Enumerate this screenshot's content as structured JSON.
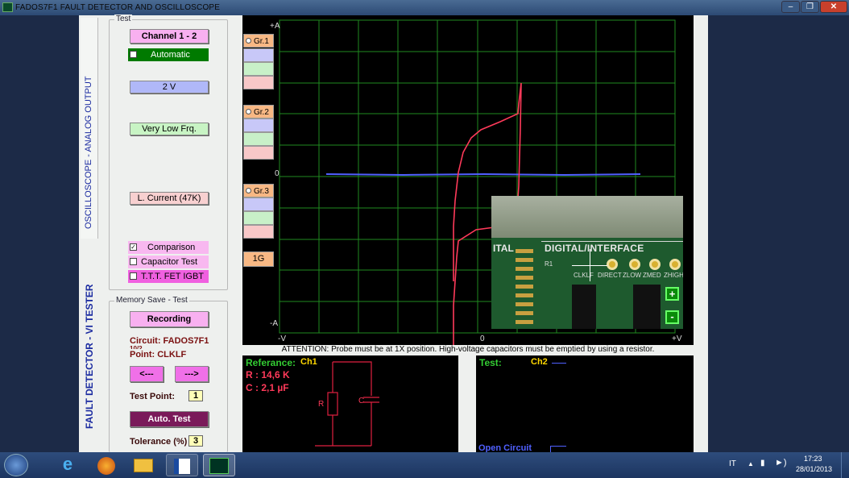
{
  "window": {
    "title": "FADOS7F1   FAULT DETECTOR AND OSCILLOSCOPE"
  },
  "tabs": {
    "oscilloscope": "OSCILLOSCOPE  -  ANALOG OUTPUT",
    "tester": "FAULT DETECTOR - VI TESTER"
  },
  "test_group": {
    "legend": "Test",
    "channel_button": "Channel 1 - 2",
    "automatic_label": "Automatic",
    "voltage_button": "2 V",
    "frequency_button": "Very Low Frq.",
    "current_button": "L. Current (47K)",
    "comparison_label": "Comparison",
    "capacitor_label": "Capacitor Test",
    "ttt_label": "T.T.T. FET  IGBT"
  },
  "memory_group": {
    "legend": "Memory Save - Test",
    "recording_button": "Recording",
    "circuit_text": "Circuit: FADOS7F1",
    "circuit_partial": "10/2",
    "point_text": "Point:  CLKLF",
    "prev_button": "<---",
    "next_button": "--->",
    "test_point_label": "Test Point:",
    "test_point_value": "1",
    "auto_test_button": "Auto. Test",
    "tolerance_label": "Tolerance (%)",
    "tolerance_value": "3"
  },
  "graph_buttons": [
    "Gr.1",
    "Gr.2",
    "Gr.3"
  ],
  "gain_button": "1G",
  "scope": {
    "top_label": "+A",
    "bottom_label": "-A",
    "zero_label": "0",
    "left_label": "-V",
    "center_label": "0",
    "right_label": "+V"
  },
  "attention": "ATTENTION: Probe must be at 1X position. High-voltage capacitors must be emptied by using a resistor.",
  "reference": {
    "title": "Referance:",
    "channel": "Ch1",
    "r_value": "R : 14,6 K",
    "c_value": "C : 2,1 µF",
    "r_label": "R",
    "c_label": "C"
  },
  "test_panel": {
    "title": "Test:",
    "channel": "Ch2",
    "status": "Open Circuit"
  },
  "photo": {
    "board_text": "DIGITAL/INTERFACE",
    "pins": [
      "R1",
      "CLKLF",
      "DIRECT",
      "ZLOW",
      "ZMED",
      "ZHIGH"
    ],
    "zoom_in": "+",
    "zoom_out": "-",
    "side": "ITAL"
  },
  "taskbar": {
    "language": "IT",
    "time": "17:23",
    "date": "28/01/2013"
  },
  "colors": {
    "trace_ref": "#ff3a5a",
    "trace_test": "#5060ff",
    "grid": "#1f8a1f",
    "accent_ok": "#007a00"
  }
}
